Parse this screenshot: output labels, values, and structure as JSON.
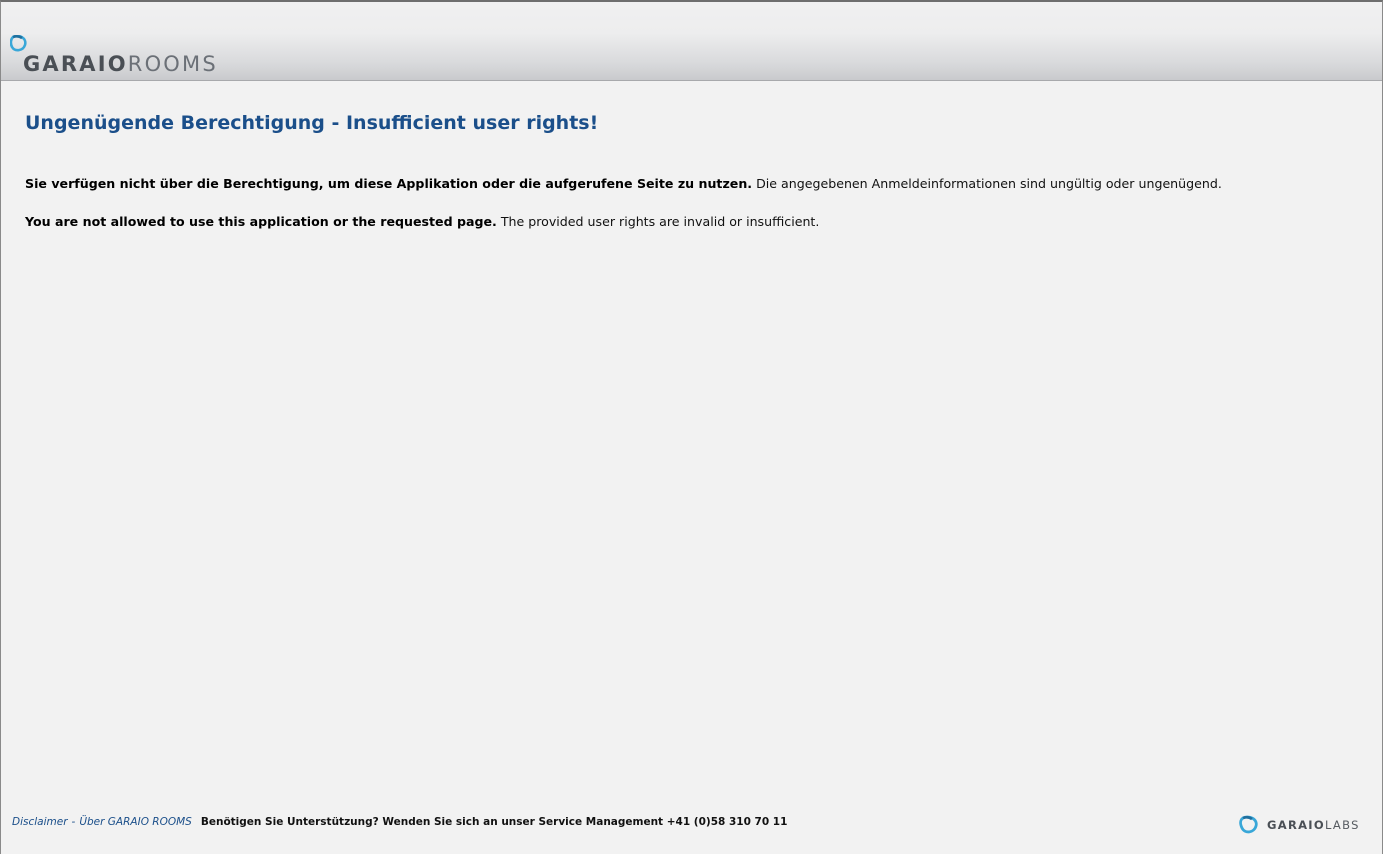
{
  "header": {
    "logo": {
      "icon": "garaio-mark-icon",
      "brand_bold": "GARAIO",
      "brand_light": "ROOMS",
      "accent_color": "#39a7d8"
    }
  },
  "main": {
    "title": "Ungenügende Berechtigung - Insufficient user rights!",
    "message_de_bold": "Sie verfügen nicht über die Berechtigung, um diese Applikation oder die aufgerufene Seite zu nutzen.",
    "message_de": " Die angegebenen Anmeldeinformationen sind ungültig oder ungenügend.",
    "message_en_bold": "You are not allowed to use this application or the requested page.",
    "message_en": " The provided user rights are invalid or insufficient."
  },
  "footer": {
    "disclaimer_link": "Disclaimer",
    "separator": "-",
    "about_link": "Über GARAIO ROOMS",
    "support_text": "Benötigen Sie Unterstützung? Wenden Sie sich an unser Service Management +41 (0)58 310 70 11",
    "labs_logo": {
      "icon": "garaio-labs-mark-icon",
      "brand_bold": "GARAIO",
      "brand_light": "LABS"
    }
  },
  "colors": {
    "title": "#1b4f8a",
    "link": "#1b4f8a",
    "background": "#f2f2f2"
  }
}
